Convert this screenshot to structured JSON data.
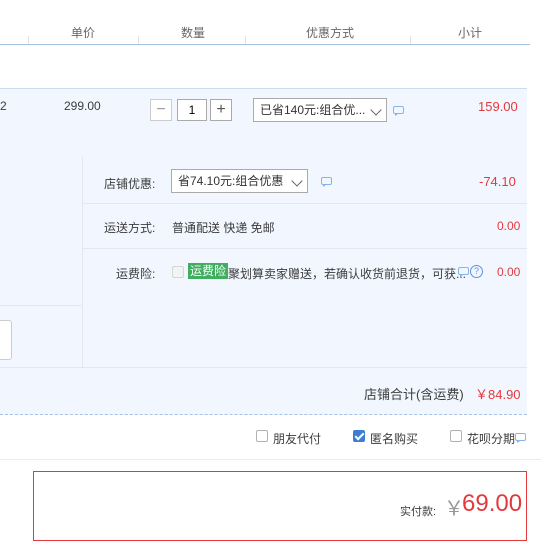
{
  "header": {
    "col_price": "单价",
    "col_qty": "数量",
    "col_promo": "优惠方式",
    "col_subtotal": "小计"
  },
  "item": {
    "index_fragment": "2",
    "unit_price": "299.00",
    "quantity": "1",
    "minus": "−",
    "plus": "+",
    "promo_select": "已省140元:组合优...",
    "subtotal": "159.00"
  },
  "shop": {
    "discount_label": "店铺优惠:",
    "discount_select": "省74.10元:组合优惠",
    "discount_value": "-74.10",
    "shipping_label": "运送方式:",
    "shipping_text": "普通配送 快递 免邮",
    "shipping_value": "0.00",
    "insurance_label": "运费险:",
    "insurance_badge": "运费险",
    "insurance_text": "聚划算卖家赠送，若确认收货前退货，可获...",
    "insurance_value": "0.00",
    "help_icon": "?"
  },
  "total": {
    "label": "店铺合计(含运费)",
    "value": "￥84.90"
  },
  "options": {
    "friend_pay": "朋友代付",
    "anonymous": "匿名购买",
    "anonymous_checked": true,
    "huabei": "花呗分期"
  },
  "payment": {
    "label": "实付款:",
    "currency": "￥",
    "amount": "69.00"
  },
  "colors": {
    "accent_red": "#e4393c",
    "link_blue": "#3d7dd8",
    "row_bg": "#f2f7ff",
    "badge_green": "#3fae5e"
  }
}
